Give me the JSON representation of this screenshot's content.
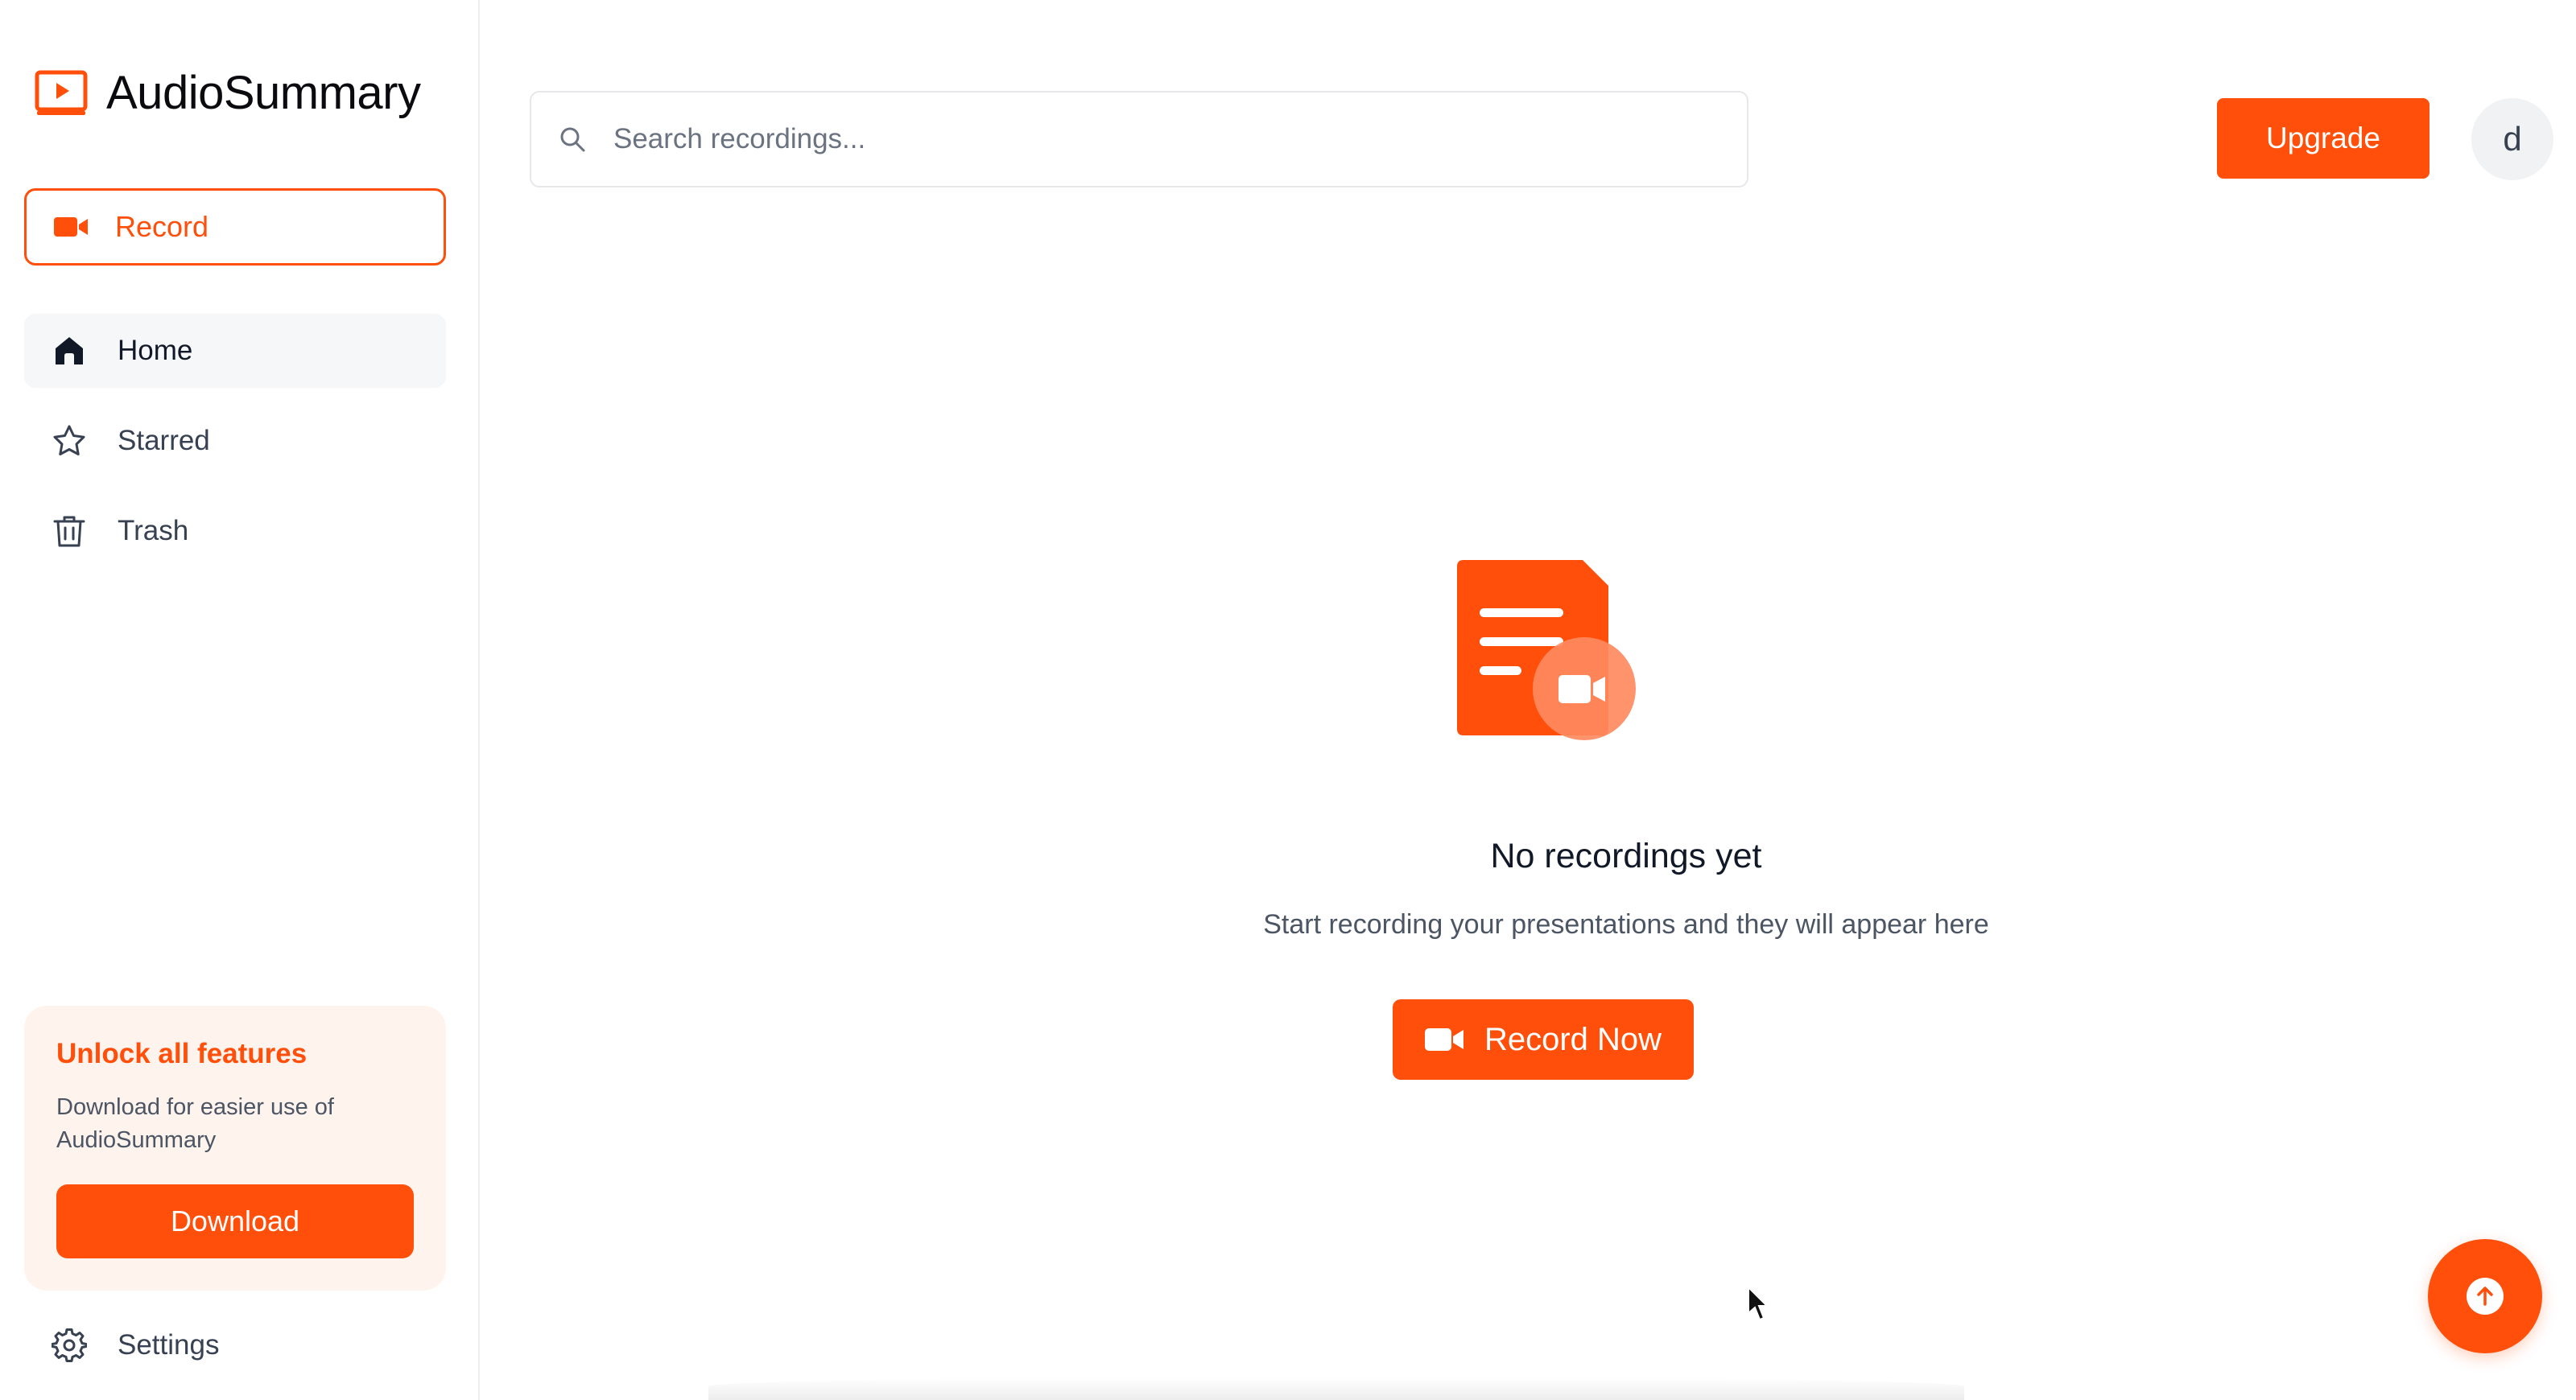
{
  "app": {
    "name": "AudioSummary",
    "accent_color": "#ff4f0a"
  },
  "sidebar": {
    "record_label": "Record",
    "items": [
      {
        "label": "Home",
        "icon": "home-icon",
        "active": true
      },
      {
        "label": "Starred",
        "icon": "star-icon",
        "active": false
      },
      {
        "label": "Trash",
        "icon": "trash-icon",
        "active": false
      }
    ],
    "promo": {
      "title": "Unlock all features",
      "text": "Download for easier use of AudioSummary",
      "button_label": "Download"
    },
    "settings_label": "Settings"
  },
  "header": {
    "search_placeholder": "Search recordings...",
    "search_value": "",
    "upgrade_label": "Upgrade",
    "avatar_initial": "d"
  },
  "empty_state": {
    "title": "No recordings yet",
    "subtitle": "Start recording your presentations and they will appear here",
    "button_label": "Record Now",
    "illustration_icon": "document-video-icon"
  },
  "fab": {
    "icon": "arrow-up-icon"
  }
}
